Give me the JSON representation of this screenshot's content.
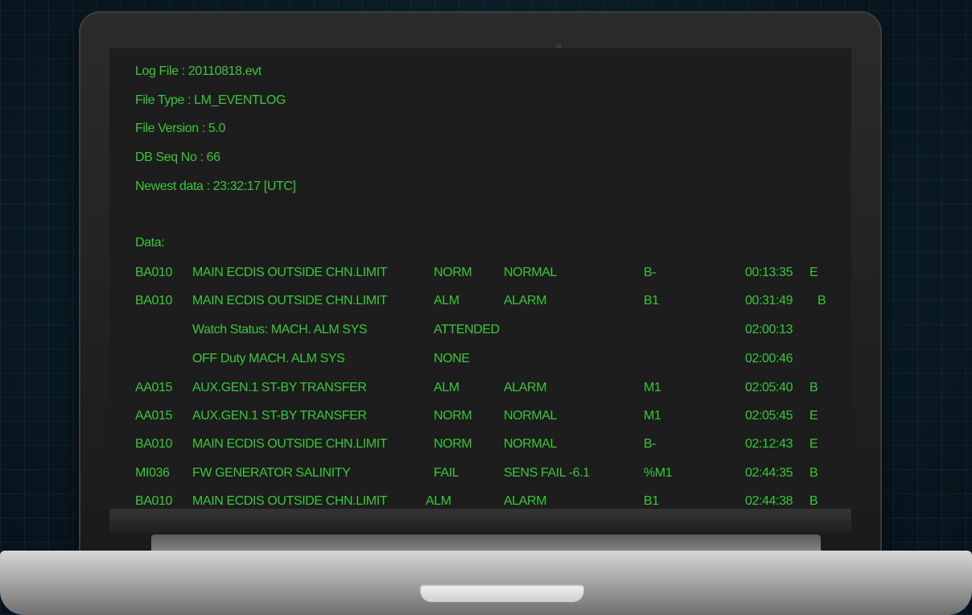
{
  "header": {
    "log_file": "Log File    : 20110818.evt",
    "file_type": "File Type    : LM_EVENTLOG",
    "file_version": "File Version : 5.0",
    "db_seq_no": "DB Seq No    : 66",
    "newest_data": "Newest data : 23:32:17 [UTC]"
  },
  "data_label": "Data:",
  "rows": [
    {
      "code": "BA010",
      "desc": "MAIN ECDIS OUTSIDE CHN.LIMIT",
      "state": "NORM",
      "text": "NORMAL",
      "group": "B-",
      "time": "00:13:35",
      "flag": "E"
    },
    {
      "code": "BA010",
      "desc": "MAIN ECDIS OUTSIDE CHN.LIMIT",
      "state": "ALM",
      "text": "ALARM",
      "group": "B1",
      "time": "00:31:49",
      "flag": "B"
    },
    {
      "code": "",
      "desc": "Watch Status: MACH. ALM SYS",
      "state": "ATTENDED",
      "text": "",
      "group": "",
      "time": "02:00:13",
      "flag": ""
    },
    {
      "code": "",
      "desc": "OFF Duty MACH. ALM SYS",
      "state": "NONE",
      "text": "",
      "group": "",
      "time": "02:00:46",
      "flag": ""
    },
    {
      "code": "AA015",
      "desc": "AUX.GEN.1 ST-BY TRANSFER",
      "state": "ALM",
      "text": "ALARM",
      "group": "M1",
      "time": "02:05:40",
      "flag": "B"
    },
    {
      "code": "AA015",
      "desc": "AUX.GEN.1 ST-BY TRANSFER",
      "state": "NORM",
      "text": "NORMAL",
      "group": "M1",
      "time": "02:05:45",
      "flag": "E"
    },
    {
      "code": "BA010",
      "desc": "MAIN ECDIS OUTSIDE CHN.LIMIT",
      "state": "NORM",
      "text": "NORMAL",
      "group": "B-",
      "time": "02:12:43",
      "flag": "E"
    },
    {
      "code": "MI036",
      "desc": "FW GENERATOR SALINITY",
      "state": "FAIL",
      "text": "SENS FAIL -6.1",
      "group": "%M1",
      "time": "02:44:35",
      "flag": "B"
    },
    {
      "code": "BA010",
      "desc": "MAIN ECDIS OUTSIDE CHN.LIMIT",
      "state": "ALM",
      "text": "ALARM",
      "group": "B1",
      "time": "02:44:38",
      "flag": "B"
    }
  ]
}
